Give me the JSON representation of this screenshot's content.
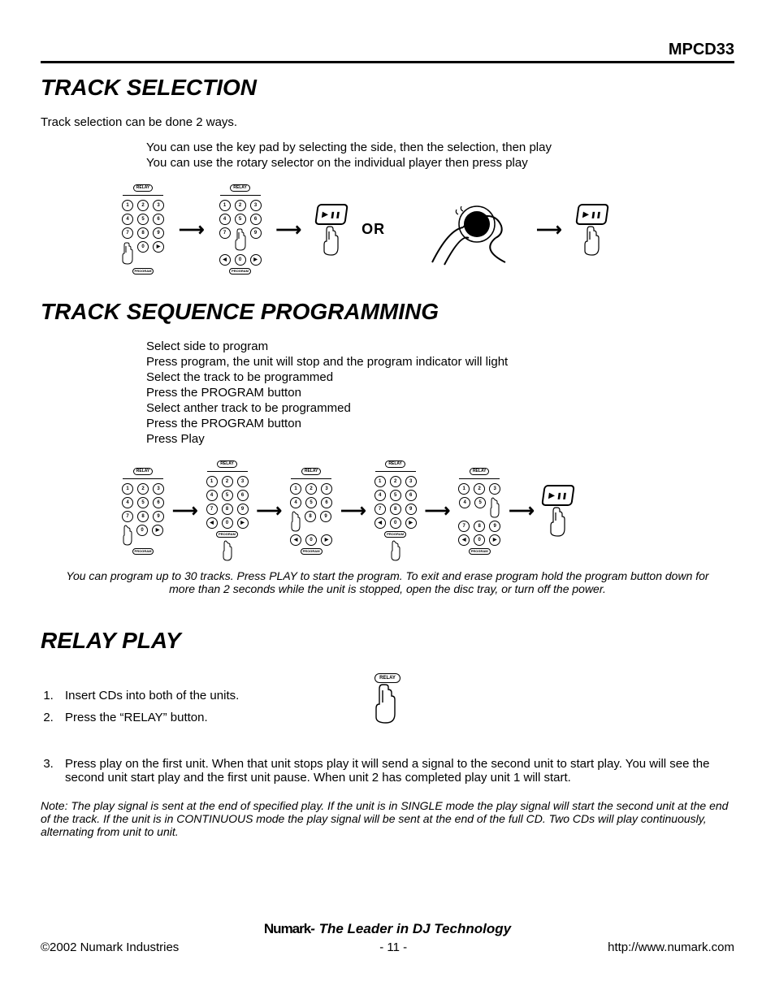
{
  "header": {
    "model": "MPCD33"
  },
  "section1": {
    "title": "TRACK SELECTION",
    "intro": "Track selection can be done 2 ways.",
    "lines": [
      "You can use the key pad by selecting the side, then the selection, then play",
      "You can use the rotary selector on the individual player then press play"
    ],
    "or_label": "OR"
  },
  "section2": {
    "title": "TRACK SEQUENCE PROGRAMMING",
    "steps": [
      "Select side to program",
      "Press program, the unit will stop and the program indicator will light",
      "Select the track to be programmed",
      "Press the PROGRAM button",
      "Select anther track to be programmed",
      "Press the PROGRAM button",
      "Press Play"
    ],
    "note": "You can program up to 30 tracks.  Press PLAY to start the program.  To exit and erase program hold the program button down for more than 2 seconds while the unit is stopped, open the disc tray, or turn off the power."
  },
  "section3": {
    "title": "RELAY PLAY",
    "items": [
      "Insert CDs into both of the units.",
      "Press the “RELAY” button.",
      "Press play on the first unit.  When that unit stops play it will send a signal to the second unit to start play.  You will see the second unit start play and the first unit pause.  When unit 2 has completed play unit 1 will start."
    ],
    "note": "Note: The play signal is sent at the end of specified play.  If the unit is in SINGLE mode the play signal will start the second unit at the end of the track.  If the unit is in CONTINUOUS mode the play signal will be sent at the end of the full CD.  Two CDs will play continuously, alternating from unit to unit."
  },
  "keypad": {
    "relay": "RELAY",
    "program": "PROGRAM",
    "keys": [
      "1",
      "2",
      "3",
      "4",
      "5",
      "6",
      "7",
      "8",
      "9",
      "◀",
      "0",
      "▶"
    ]
  },
  "footer": {
    "brand": "Numark",
    "tagline": "- The Leader in DJ Technology",
    "copyright": "©2002 Numark Industries",
    "page": "- 11 -",
    "url": "http://www.numark.com"
  }
}
